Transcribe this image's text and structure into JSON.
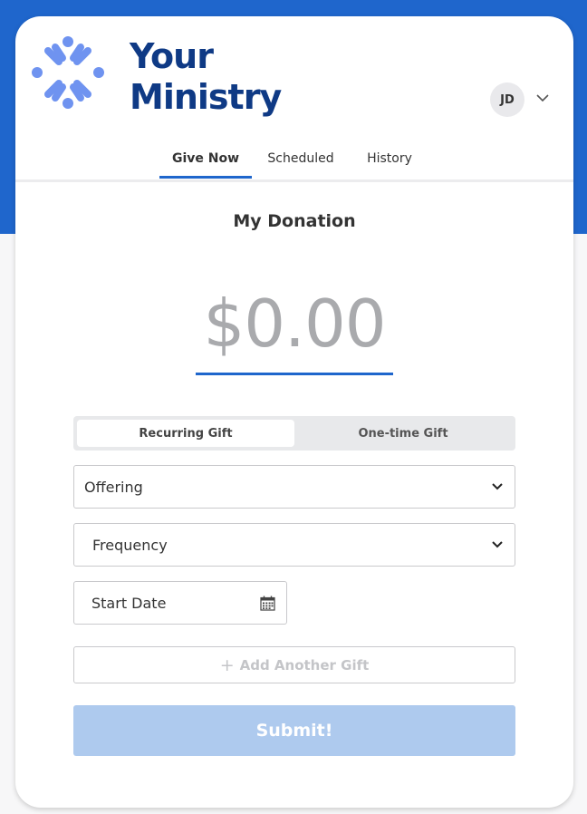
{
  "header": {
    "logo": {
      "line1": "Your",
      "line2": "Ministry"
    },
    "user": {
      "initials": "JD"
    }
  },
  "tabs": [
    {
      "label": "Give Now",
      "active": true
    },
    {
      "label": "Scheduled",
      "active": false
    },
    {
      "label": "History",
      "active": false
    }
  ],
  "donation": {
    "title": "My Donation",
    "amount": "$0.00"
  },
  "gift_type": {
    "options": [
      "Recurring Gift",
      "One-time Gift"
    ],
    "selected": "Recurring Gift"
  },
  "form": {
    "fund_select": {
      "value": "Offering"
    },
    "frequency_select": {
      "value": "Frequency"
    },
    "start_date": {
      "placeholder": "Start Date"
    },
    "add_gift_label": "Add Another Gift",
    "submit_label": "Submit!"
  },
  "colors": {
    "brand_blue": "#1f66cc",
    "logo_navy": "#0f3a85",
    "logo_light": "#6f93f0",
    "submit_disabled": "#aecaee"
  },
  "icons": {
    "logo_mark": "people-circle-icon",
    "user_menu": "chevron-down-icon",
    "select_arrow": "chevron-down-icon",
    "date_picker": "calendar-icon",
    "add": "plus-icon"
  }
}
